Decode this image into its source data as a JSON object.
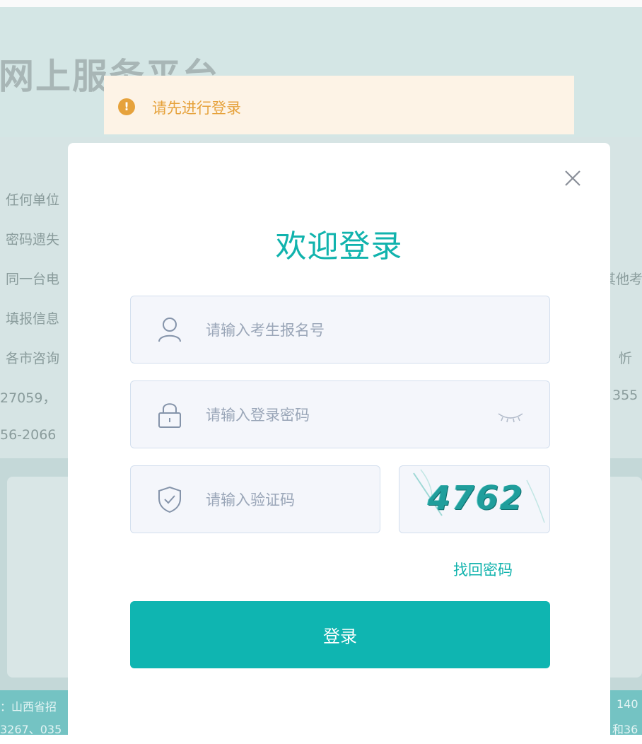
{
  "background": {
    "title": "网上服务平台",
    "notice_lines": [
      "任何单位",
      "密码遗失",
      "同一台电",
      "填报信息",
      "各市咨询",
      "27059，",
      "56-2066"
    ],
    "right_fragments": [
      "其他考",
      "，忻",
      "355"
    ],
    "footer_left": [
      "：山西省招",
      "3267、035"
    ],
    "footer_right": [
      "140",
      "和36"
    ]
  },
  "toast": {
    "icon": "!",
    "message": "请先进行登录"
  },
  "modal": {
    "title": "欢迎登录",
    "username_placeholder": "请输入考生报名号",
    "password_placeholder": "请输入登录密码",
    "captcha_placeholder": "请输入验证码",
    "captcha_text": "4762",
    "forgot_label": "找回密码",
    "login_label": "登录"
  },
  "colors": {
    "accent": "#11b3ad",
    "warning": "#e6a23c",
    "warning_bg": "#fdf3e6"
  }
}
